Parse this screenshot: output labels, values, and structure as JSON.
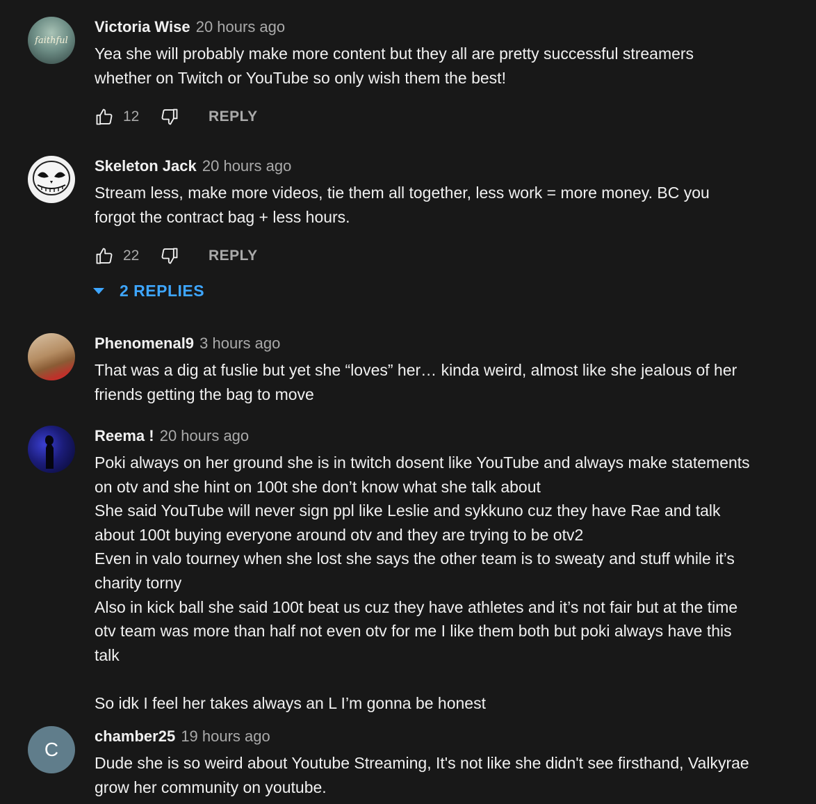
{
  "comments": [
    {
      "author": "Victoria Wise",
      "time": "20 hours ago",
      "text": "Yea she will probably make more content but they all are pretty successful streamers whether on Twitch or YouTube so only wish them the best!",
      "likes": "12",
      "reply_label": "REPLY",
      "avatar_text": "faithful"
    },
    {
      "author": "Skeleton Jack",
      "time": "20 hours ago",
      "text": "Stream less, make more videos, tie them all together, less work = more money.  BC you forgot the contract bag + less hours.",
      "likes": "22",
      "reply_label": "REPLY",
      "replies_label": "2 REPLIES"
    },
    {
      "author": "Phenomenal9",
      "time": "3 hours ago",
      "text": "That was a dig at fuslie but yet she “loves” her… kinda weird, almost like she jealous of her friends getting the bag to move"
    },
    {
      "author": "Reema !",
      "time": "20 hours ago",
      "text": "Poki always on her ground she is in twitch dosent like YouTube and always make statements on otv and she hint on 100t she don’t know what she talk about\nShe said YouTube will never sign ppl like Leslie and sykkuno cuz they have Rae and talk about 100t buying everyone around otv and they are trying to be otv2\nEven in valo tourney when she lost she says the other team is to sweaty and stuff while it’s charity torny\nAlso in kick ball she said 100t beat us cuz they have athletes and it’s not fair but at the time otv team was more than half not even otv for me I like them both but poki always have this talk\n\nSo idk I feel her takes always an L I’m gonna be honest"
    },
    {
      "author": "chamber25",
      "time": "19 hours ago",
      "text": "Dude she is so weird about Youtube Streaming, It's not like she didn't see firsthand, Valkyrae grow her community on youtube.",
      "avatar_letter": "C"
    }
  ],
  "colors": {
    "background": "#181818",
    "text": "#f1f1f1",
    "meta": "#aaaaaa",
    "link": "#3ea6ff"
  }
}
